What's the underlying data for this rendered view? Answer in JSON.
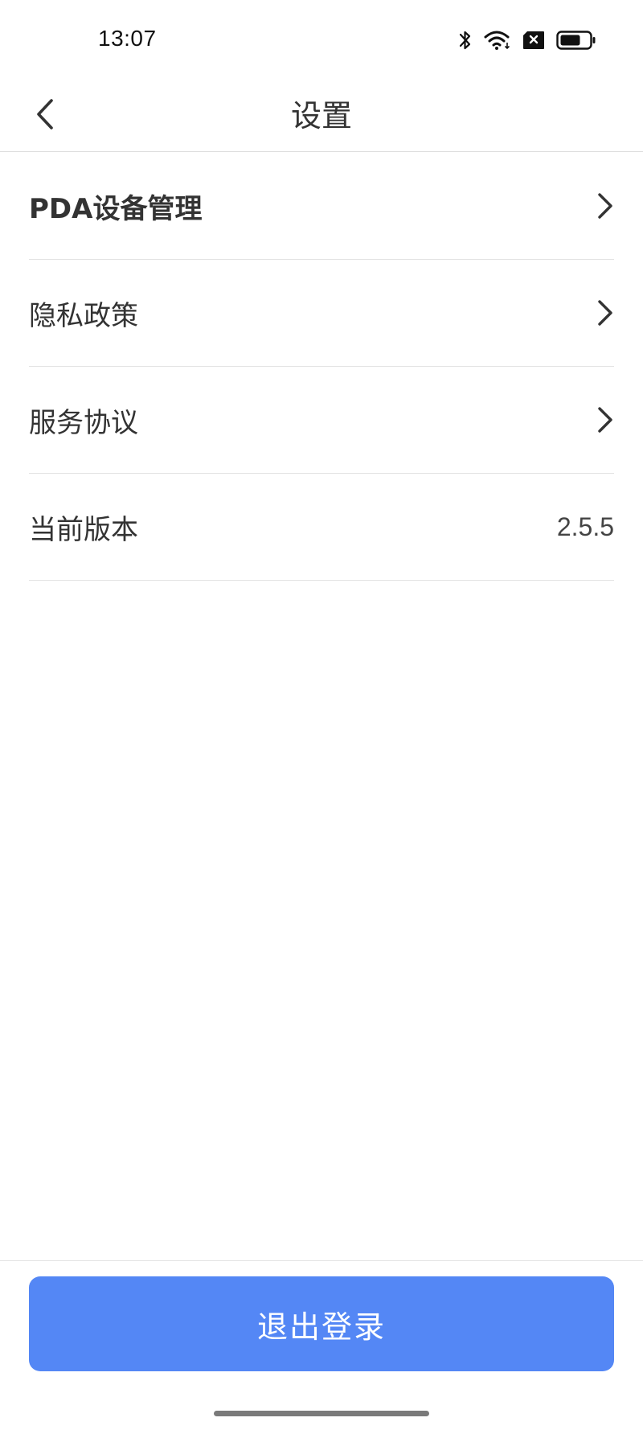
{
  "status_bar": {
    "time": "13:07",
    "icons": [
      "bluetooth-icon",
      "wifi-icon",
      "sim-blocked-icon",
      "battery-icon"
    ]
  },
  "nav": {
    "title": "设置",
    "back_icon": "chevron-left-icon"
  },
  "menu": {
    "items": [
      {
        "label": "PDA设备管理",
        "has_chevron": true
      },
      {
        "label": "隐私政策",
        "has_chevron": true
      },
      {
        "label": "服务协议",
        "has_chevron": true
      },
      {
        "label": "当前版本",
        "value": "2.5.5"
      }
    ]
  },
  "logout": {
    "label": "退出登录",
    "color": "#5487f5"
  }
}
